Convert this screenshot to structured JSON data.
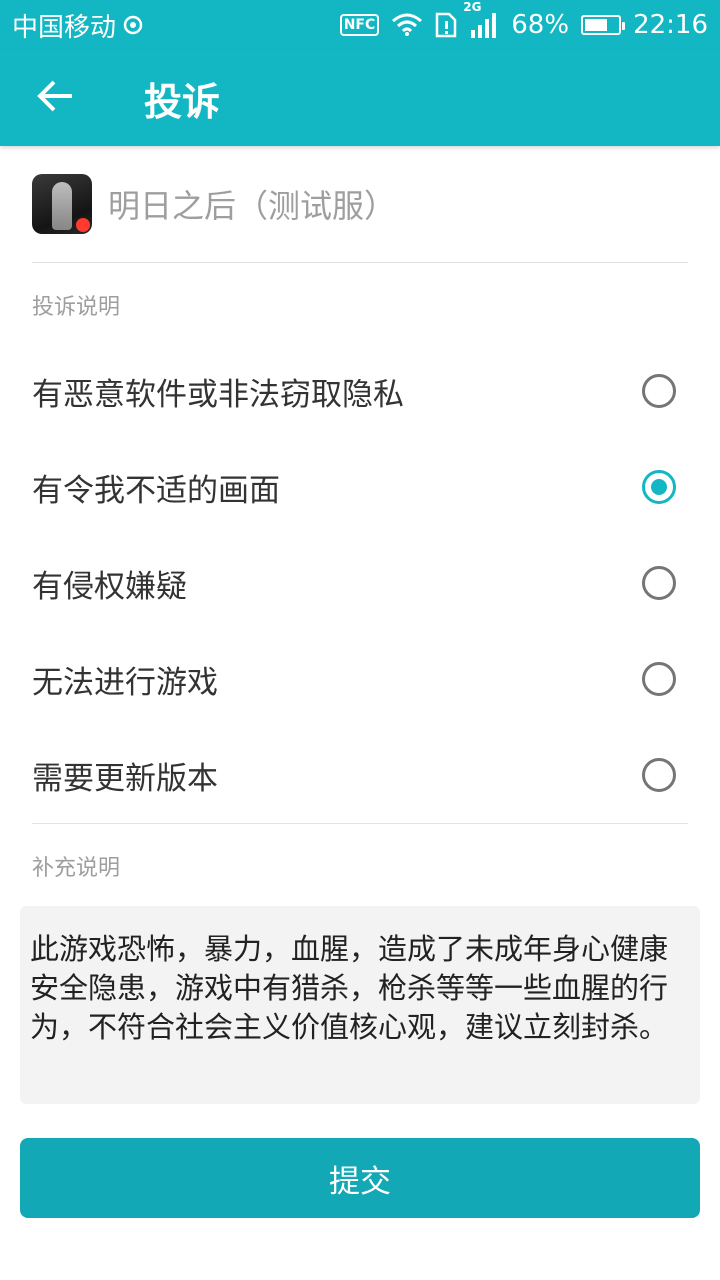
{
  "status_bar": {
    "carrier": "中国移动",
    "nfc": "NFC",
    "network": "2G",
    "battery_percent": "68%",
    "battery_level": 0.68,
    "time": "22:16",
    "icons": [
      "carrier-signal-icon",
      "nfc-icon",
      "wifi-icon",
      "sim-alert-icon",
      "cellular-signal-icon",
      "battery-icon"
    ]
  },
  "app_bar": {
    "title": "投诉",
    "back_icon": "arrow-left-icon"
  },
  "game": {
    "name": "明日之后（测试服）"
  },
  "complaint": {
    "section_label": "投诉说明",
    "options": [
      {
        "label": "有恶意软件或非法窃取隐私",
        "checked": false
      },
      {
        "label": "有令我不适的画面",
        "checked": true
      },
      {
        "label": "有侵权嫌疑",
        "checked": false
      },
      {
        "label": "无法进行游戏",
        "checked": false
      },
      {
        "label": "需要更新版本",
        "checked": false
      }
    ]
  },
  "supplement": {
    "section_label": "补充说明",
    "text": "此游戏恐怖，暴力，血腥，造成了未成年身心健康安全隐患，游戏中有猎杀，枪杀等等一些血腥的行为，不符合社会主义价值核心观，建议立刻封杀。"
  },
  "submit": {
    "label": "提交"
  },
  "colors": {
    "primary": "#13b7c3",
    "button": "#13a8b6",
    "text_primary": "#333333",
    "text_secondary": "#9e9e9e"
  }
}
